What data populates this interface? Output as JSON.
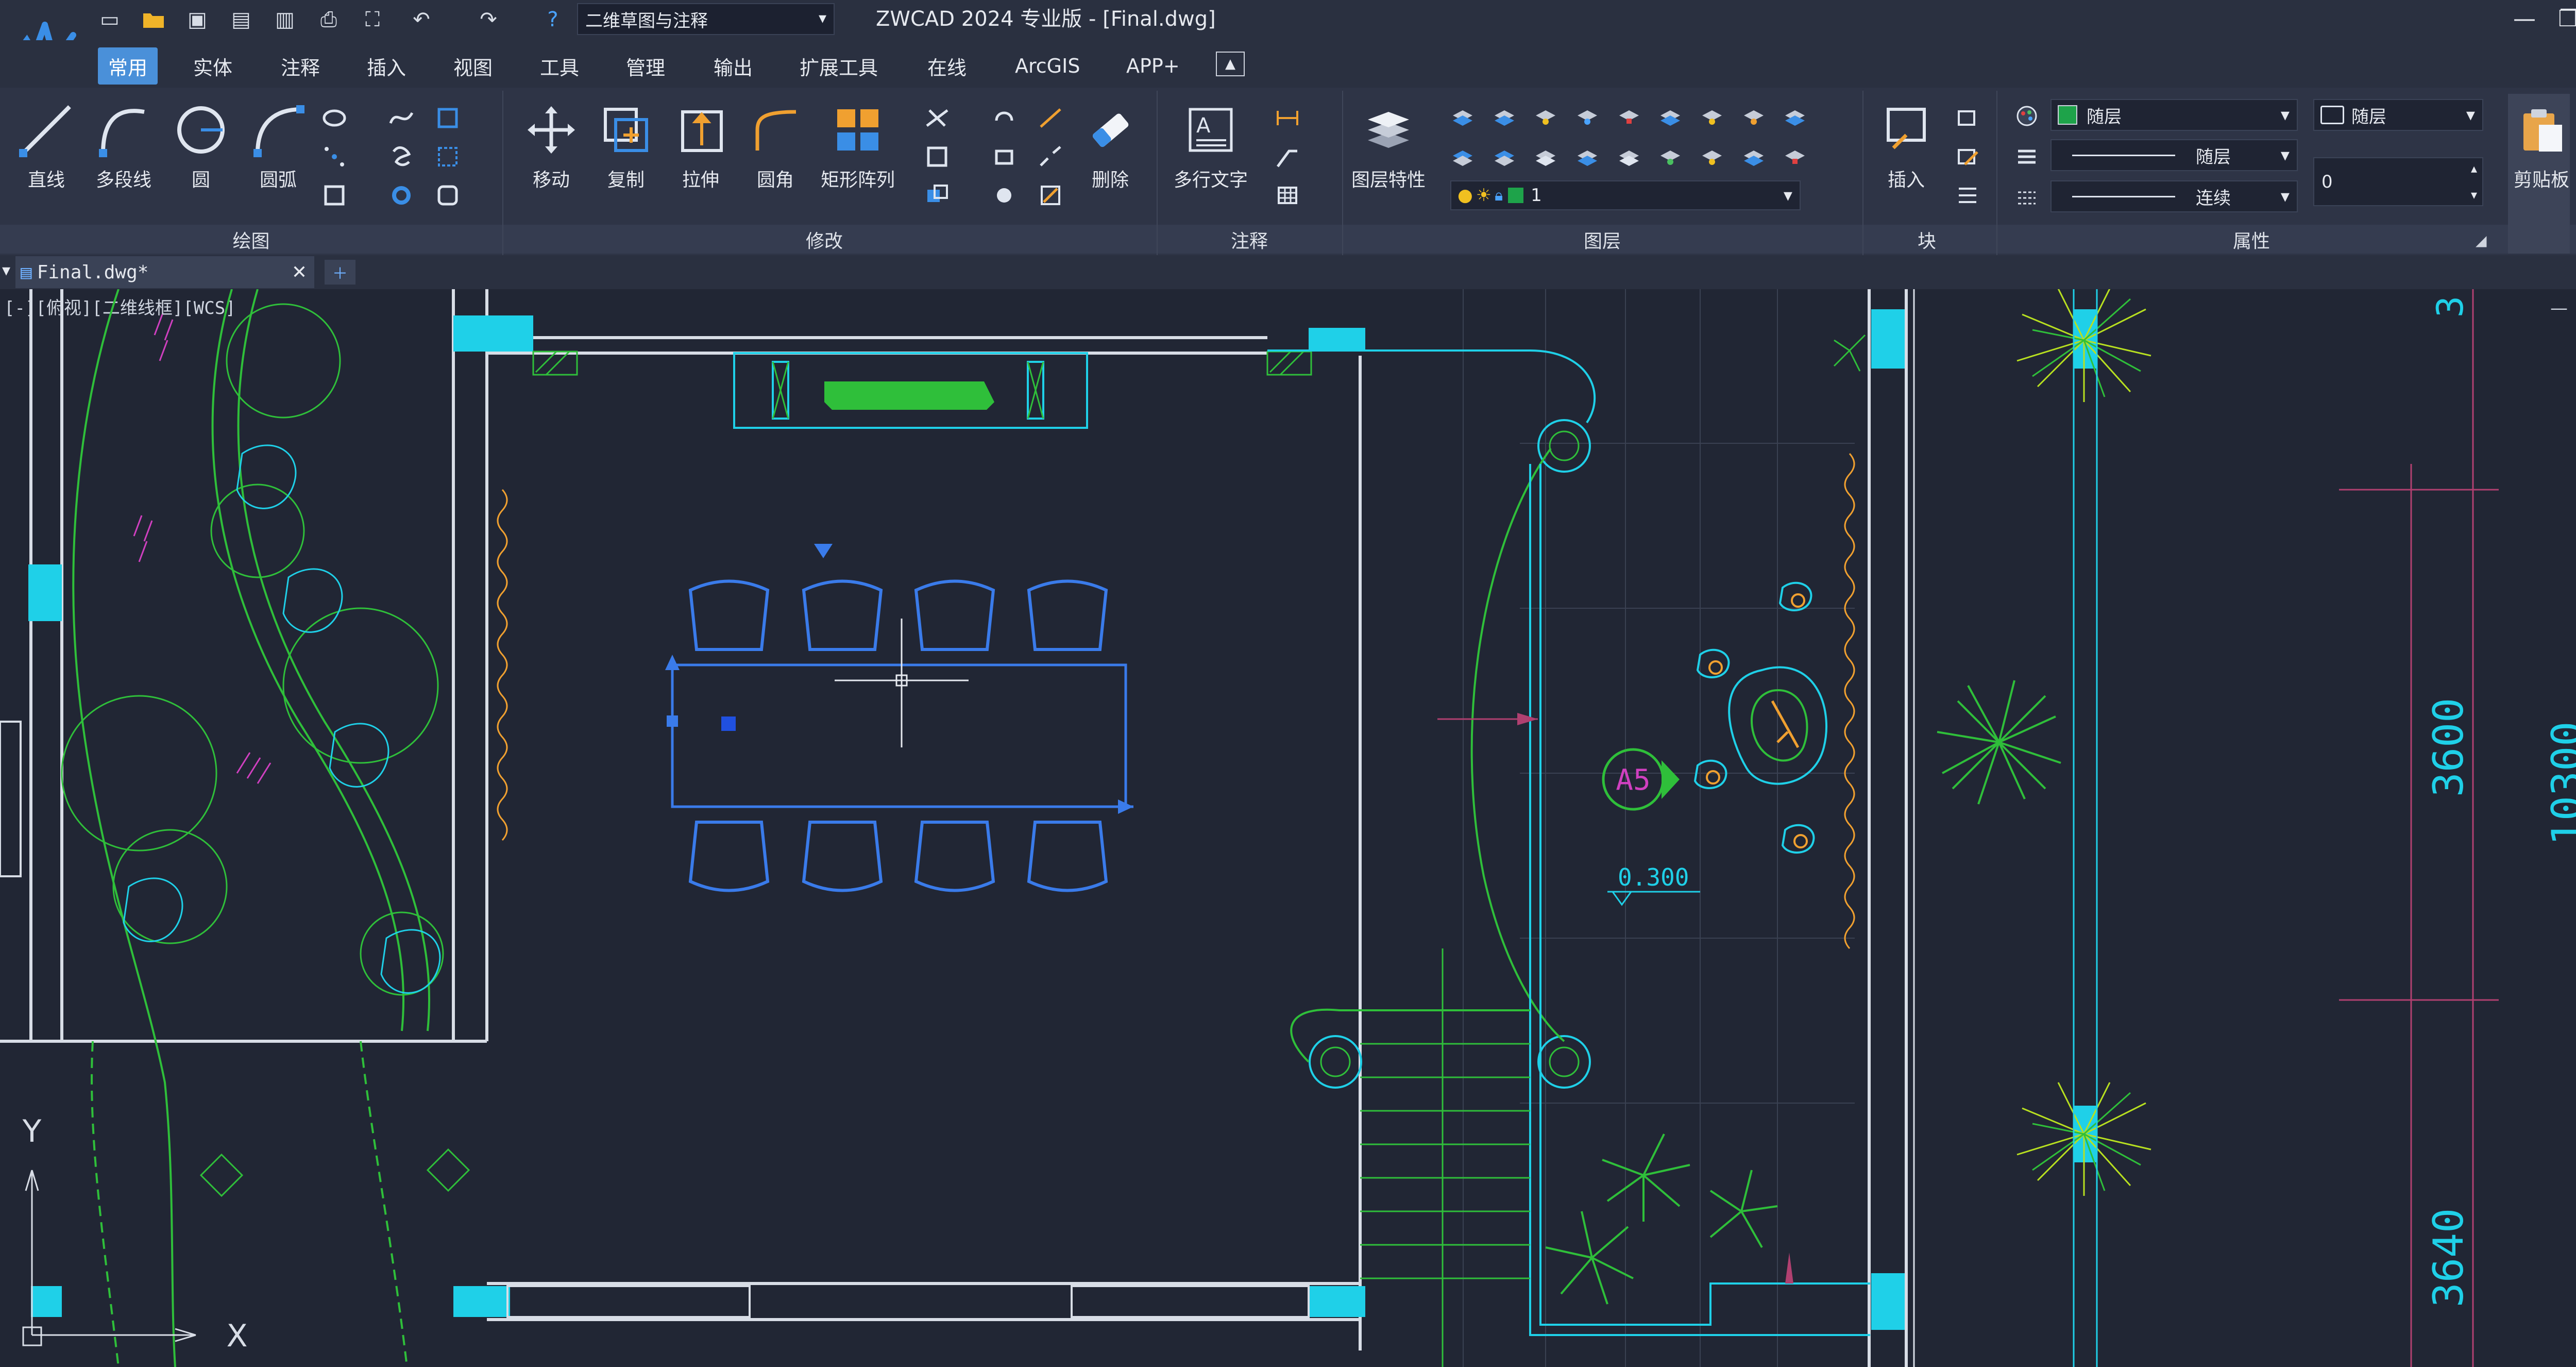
{
  "titlebar": {
    "workspace": "二维草图与注释",
    "title": "ZWCAD 2024 专业版 - [Final.dwg]",
    "minimize": "—",
    "maximize": "❐",
    "close": "✕"
  },
  "menu": {
    "tabs": [
      "常用",
      "实体",
      "注释",
      "插入",
      "视图",
      "工具",
      "管理",
      "输出",
      "扩展工具",
      "在线",
      "ArcGIS",
      "APP+"
    ]
  },
  "ribbon": {
    "draw": {
      "panel": "绘图",
      "line": "直线",
      "polyline": "多段线",
      "circle": "圆",
      "arc": "圆弧"
    },
    "modify": {
      "panel": "修改",
      "move": "移动",
      "copy": "复制",
      "stretch": "拉伸",
      "fillet": "圆角",
      "array": "矩形阵列",
      "erase": "删除"
    },
    "annotate": {
      "panel": "注释",
      "mtext": "多行文字"
    },
    "layers": {
      "panel": "图层",
      "props": "图层特性",
      "current_layer": "1"
    },
    "block": {
      "panel": "块",
      "insert": "插入"
    },
    "properties": {
      "panel": "属性",
      "color": "随层",
      "linetype": "随层",
      "lineweight": "连续",
      "plotstyle": "随层",
      "value": "0"
    },
    "clipboard": {
      "label": "剪贴板"
    }
  },
  "document": {
    "tab_label": "Final.dwg*",
    "viewport_label": "[-][俯视][二维线框][WCS]"
  },
  "drawing": {
    "tag": "A5",
    "level": "0.300",
    "dim_1": "3600",
    "dim_2": "10300",
    "dim_3": "3640",
    "dim_top": "3",
    "axis_y": "Y",
    "axis_x": "X"
  },
  "colors": {
    "accent": "#4a90d9",
    "canvas": "#212634",
    "cyan": "#1fd0e8",
    "green": "#2fbf3a",
    "blue_furniture": "#3a7bea"
  }
}
